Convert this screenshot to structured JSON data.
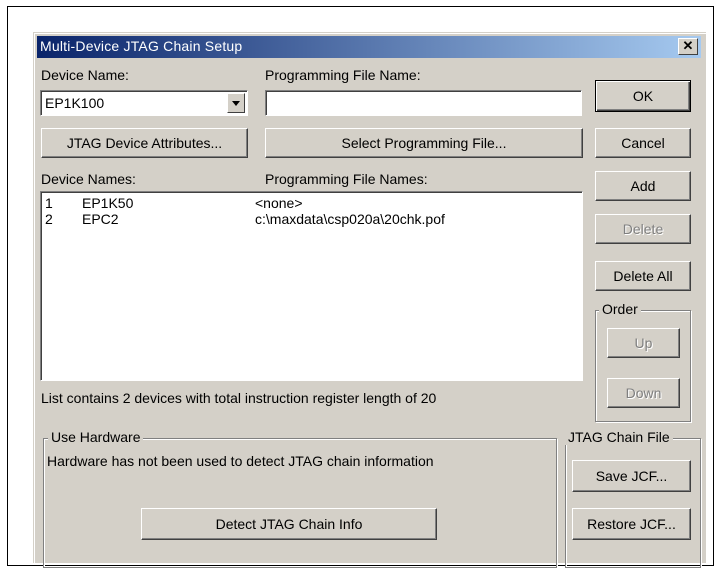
{
  "dialog": {
    "title": "Multi-Device JTAG Chain Setup",
    "close_glyph": "✕"
  },
  "labels": {
    "device_name": "Device Name:",
    "programming_file_name": "Programming File Name:",
    "device_names": "Device Names:",
    "programming_file_names": "Programming File Names:",
    "list_status": "List contains 2 devices with total instruction register length of 20"
  },
  "device_combo": {
    "value": "EP1K100"
  },
  "programming_file_input": {
    "value": ""
  },
  "buttons": {
    "jtag_attributes": "JTAG Device Attributes...",
    "select_file": "Select Programming File...",
    "ok": "OK",
    "cancel": "Cancel",
    "add": "Add",
    "delete": "Delete",
    "delete_all": "Delete All",
    "up": "Up",
    "down": "Down",
    "save_jcf": "Save JCF...",
    "restore_jcf": "Restore JCF...",
    "detect": "Detect JTAG Chain Info"
  },
  "device_list": [
    {
      "index": "1",
      "name": "EP1K50",
      "file": "<none>"
    },
    {
      "index": "2",
      "name": "EPC2",
      "file": "c:\\maxdata\\csp020a\\20chk.pof"
    }
  ],
  "groups": {
    "order": "Order",
    "use_hardware": "Use Hardware",
    "hardware_status": "Hardware has not been used to detect JTAG chain information",
    "jtag_chain_file": "JTAG Chain File"
  }
}
